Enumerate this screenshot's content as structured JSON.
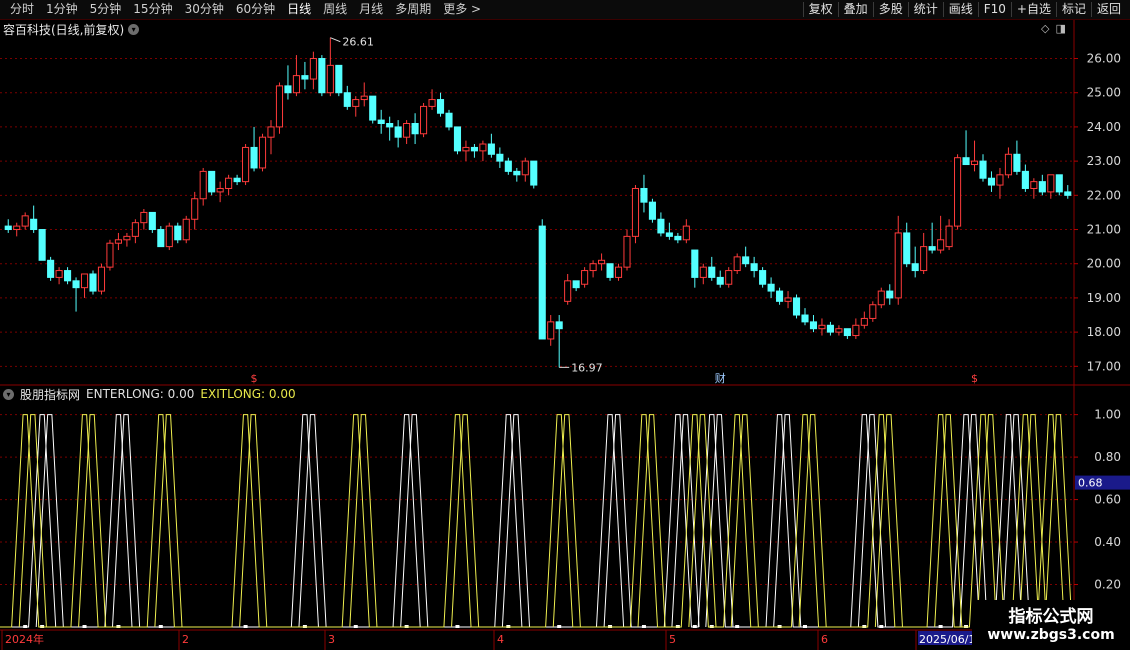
{
  "toolbar": {
    "periods": [
      "分时",
      "1分钟",
      "5分钟",
      "15分钟",
      "30分钟",
      "60分钟",
      "日线",
      "周线",
      "月线",
      "多周期",
      "更多 >"
    ],
    "active_period": "日线",
    "actions": [
      "复权",
      "叠加",
      "多股",
      "统计",
      "画线",
      "F10",
      "+自选",
      "标记",
      "返回"
    ]
  },
  "chart_title": "容百科技(日线,前复权)",
  "main_price_labels": {
    "high": "26.61",
    "low": "16.97"
  },
  "event_markers": [
    "$",
    "财",
    "$"
  ],
  "indicator": {
    "name": "股朋指标网",
    "enterlong": "ENTERLONG: 0.00",
    "exitlong": "EXITLONG: 0.00",
    "current_value": "0.68"
  },
  "date_axis": [
    "2024年",
    "2",
    "3",
    "4",
    "5",
    "6",
    "2025/06/1"
  ],
  "watermark": {
    "line1": "指标公式网",
    "line2": "www.zbgs3.com"
  },
  "colors": {
    "up": "#ff3b3b",
    "down": "#54ffff",
    "grid": "#7a0000",
    "enter": "#ffffff",
    "exit": "#f0f050"
  },
  "chart_data": [
    {
      "type": "candlestick",
      "title": "容百科技(日线,前复权)",
      "ylim": [
        16.6,
        26.6
      ],
      "yticks": [
        17.0,
        18.0,
        19.0,
        20.0,
        21.0,
        22.0,
        23.0,
        24.0,
        25.0,
        26.0
      ],
      "annotations": [
        {
          "label": "26.61",
          "value": 26.61
        },
        {
          "label": "16.97",
          "value": 16.97
        }
      ],
      "ohlc": [
        [
          21.1,
          21.3,
          20.9,
          21.0
        ],
        [
          21.0,
          21.2,
          20.8,
          21.1
        ],
        [
          21.1,
          21.5,
          21.0,
          21.4
        ],
        [
          21.3,
          21.7,
          20.9,
          21.0
        ],
        [
          21.0,
          21.0,
          20.1,
          20.1
        ],
        [
          20.1,
          20.2,
          19.5,
          19.6
        ],
        [
          19.6,
          19.9,
          19.4,
          19.8
        ],
        [
          19.8,
          19.9,
          19.4,
          19.5
        ],
        [
          19.5,
          19.6,
          18.6,
          19.3
        ],
        [
          19.3,
          19.7,
          19.0,
          19.7
        ],
        [
          19.7,
          19.8,
          19.1,
          19.2
        ],
        [
          19.2,
          20.0,
          19.1,
          19.9
        ],
        [
          19.9,
          20.7,
          19.8,
          20.6
        ],
        [
          20.6,
          20.9,
          20.4,
          20.7
        ],
        [
          20.7,
          20.9,
          20.5,
          20.8
        ],
        [
          20.8,
          21.3,
          20.6,
          21.2
        ],
        [
          21.2,
          21.6,
          21.0,
          21.5
        ],
        [
          21.5,
          21.5,
          20.9,
          21.0
        ],
        [
          21.0,
          21.1,
          20.5,
          20.5
        ],
        [
          20.5,
          21.2,
          20.4,
          21.1
        ],
        [
          21.1,
          21.2,
          20.6,
          20.7
        ],
        [
          20.7,
          21.4,
          20.6,
          21.3
        ],
        [
          21.3,
          22.1,
          21.0,
          21.9
        ],
        [
          21.9,
          22.8,
          21.7,
          22.7
        ],
        [
          22.7,
          22.7,
          22.0,
          22.1
        ],
        [
          22.1,
          22.4,
          21.8,
          22.2
        ],
        [
          22.2,
          22.6,
          22.0,
          22.5
        ],
        [
          22.5,
          22.6,
          22.3,
          22.4
        ],
        [
          22.4,
          23.5,
          22.3,
          23.4
        ],
        [
          23.4,
          24.0,
          22.7,
          22.8
        ],
        [
          22.8,
          23.8,
          22.7,
          23.7
        ],
        [
          23.7,
          24.2,
          23.2,
          24.0
        ],
        [
          24.0,
          25.3,
          23.8,
          25.2
        ],
        [
          25.2,
          25.8,
          24.8,
          25.0
        ],
        [
          25.0,
          26.1,
          24.9,
          25.5
        ],
        [
          25.5,
          25.9,
          25.1,
          25.4
        ],
        [
          25.4,
          26.2,
          25.1,
          26.0
        ],
        [
          26.0,
          26.1,
          24.9,
          25.0
        ],
        [
          25.0,
          26.61,
          24.9,
          25.8
        ],
        [
          25.8,
          25.8,
          24.9,
          25.0
        ],
        [
          25.0,
          25.2,
          24.5,
          24.6
        ],
        [
          24.6,
          24.9,
          24.3,
          24.8
        ],
        [
          24.8,
          25.3,
          24.6,
          24.9
        ],
        [
          24.9,
          24.9,
          24.1,
          24.2
        ],
        [
          24.2,
          24.5,
          23.8,
          24.1
        ],
        [
          24.1,
          24.3,
          23.6,
          24.0
        ],
        [
          24.0,
          24.2,
          23.4,
          23.7
        ],
        [
          23.7,
          24.2,
          23.5,
          24.1
        ],
        [
          24.1,
          24.4,
          23.5,
          23.8
        ],
        [
          23.8,
          24.7,
          23.7,
          24.6
        ],
        [
          24.6,
          25.1,
          24.5,
          24.8
        ],
        [
          24.8,
          25.0,
          24.3,
          24.4
        ],
        [
          24.4,
          24.5,
          23.9,
          24.0
        ],
        [
          24.0,
          24.0,
          23.2,
          23.3
        ],
        [
          23.3,
          23.6,
          23.0,
          23.4
        ],
        [
          23.4,
          23.5,
          23.1,
          23.3
        ],
        [
          23.3,
          23.6,
          23.0,
          23.5
        ],
        [
          23.5,
          23.8,
          23.1,
          23.2
        ],
        [
          23.2,
          23.4,
          22.8,
          23.0
        ],
        [
          23.0,
          23.1,
          22.6,
          22.7
        ],
        [
          22.7,
          22.8,
          22.4,
          22.6
        ],
        [
          22.6,
          23.1,
          22.4,
          23.0
        ],
        [
          23.0,
          23.0,
          22.2,
          22.3
        ],
        [
          21.1,
          21.3,
          17.8,
          17.8
        ],
        [
          17.8,
          18.5,
          17.6,
          18.3
        ],
        [
          18.3,
          18.5,
          16.97,
          18.1
        ],
        [
          18.9,
          19.7,
          18.8,
          19.5
        ],
        [
          19.5,
          19.5,
          19.2,
          19.3
        ],
        [
          19.4,
          19.9,
          19.3,
          19.8
        ],
        [
          19.8,
          20.1,
          19.6,
          20.0
        ],
        [
          20.0,
          20.3,
          19.8,
          20.1
        ],
        [
          20.0,
          20.0,
          19.5,
          19.6
        ],
        [
          19.6,
          20.0,
          19.5,
          19.9
        ],
        [
          19.9,
          21.0,
          19.8,
          20.8
        ],
        [
          20.8,
          22.3,
          20.6,
          22.2
        ],
        [
          22.2,
          22.6,
          21.5,
          21.8
        ],
        [
          21.8,
          21.9,
          21.2,
          21.3
        ],
        [
          21.3,
          21.5,
          20.8,
          20.9
        ],
        [
          20.9,
          21.2,
          20.7,
          20.8
        ],
        [
          20.8,
          20.9,
          20.6,
          20.7
        ],
        [
          20.7,
          21.3,
          20.6,
          21.1
        ],
        [
          20.4,
          20.4,
          19.3,
          19.6
        ],
        [
          19.6,
          20.0,
          19.4,
          19.9
        ],
        [
          19.9,
          20.2,
          19.5,
          19.6
        ],
        [
          19.6,
          19.8,
          19.3,
          19.4
        ],
        [
          19.4,
          19.9,
          19.3,
          19.8
        ],
        [
          19.8,
          20.3,
          19.7,
          20.2
        ],
        [
          20.2,
          20.5,
          19.9,
          20.0
        ],
        [
          20.0,
          20.2,
          19.6,
          19.8
        ],
        [
          19.8,
          19.9,
          19.3,
          19.4
        ],
        [
          19.4,
          19.6,
          19.0,
          19.2
        ],
        [
          19.2,
          19.3,
          18.8,
          18.9
        ],
        [
          18.9,
          19.2,
          18.7,
          19.0
        ],
        [
          19.0,
          19.1,
          18.4,
          18.5
        ],
        [
          18.5,
          18.7,
          18.2,
          18.3
        ],
        [
          18.3,
          18.5,
          18.0,
          18.1
        ],
        [
          18.1,
          18.4,
          17.9,
          18.2
        ],
        [
          18.2,
          18.3,
          17.9,
          18.0
        ],
        [
          18.0,
          18.2,
          17.9,
          18.1
        ],
        [
          18.1,
          18.1,
          17.8,
          17.9
        ],
        [
          17.9,
          18.4,
          17.8,
          18.2
        ],
        [
          18.2,
          18.6,
          18.1,
          18.4
        ],
        [
          18.4,
          18.9,
          18.3,
          18.8
        ],
        [
          18.8,
          19.3,
          18.7,
          19.2
        ],
        [
          19.2,
          19.4,
          18.8,
          19.0
        ],
        [
          19.0,
          21.4,
          18.8,
          20.9
        ],
        [
          20.9,
          21.2,
          19.9,
          20.0
        ],
        [
          20.0,
          20.5,
          19.6,
          19.8
        ],
        [
          19.8,
          20.9,
          19.7,
          20.5
        ],
        [
          20.5,
          21.2,
          20.3,
          20.4
        ],
        [
          20.4,
          21.4,
          20.3,
          20.7
        ],
        [
          20.5,
          21.3,
          20.4,
          21.1
        ],
        [
          21.1,
          23.2,
          21.0,
          23.1
        ],
        [
          23.1,
          23.9,
          22.9,
          22.9
        ],
        [
          22.9,
          23.6,
          22.7,
          23.0
        ],
        [
          23.0,
          23.2,
          22.4,
          22.5
        ],
        [
          22.5,
          22.7,
          22.1,
          22.3
        ],
        [
          22.3,
          22.8,
          21.9,
          22.6
        ],
        [
          22.6,
          23.4,
          22.5,
          23.2
        ],
        [
          23.2,
          23.6,
          22.6,
          22.7
        ],
        [
          22.7,
          22.9,
          22.1,
          22.2
        ],
        [
          22.2,
          22.5,
          21.9,
          22.4
        ],
        [
          22.4,
          22.6,
          22.0,
          22.1
        ],
        [
          22.1,
          22.6,
          21.9,
          22.6
        ],
        [
          22.6,
          22.6,
          22.0,
          22.1
        ],
        [
          22.1,
          22.3,
          21.9,
          22.0
        ]
      ]
    },
    {
      "type": "line",
      "title": "股朋指标网",
      "ylim": [
        0,
        1.05
      ],
      "yticks": [
        0.2,
        0.4,
        0.6,
        0.8,
        1.0
      ],
      "series": [
        {
          "name": "ENTERLONG",
          "peaks": [
            4,
            13,
            35,
            47,
            59,
            71,
            79,
            83,
            91,
            101,
            113,
            118
          ]
        },
        {
          "name": "EXITLONG",
          "peaks": [
            2,
            9,
            18,
            28,
            41,
            53,
            65,
            75,
            81,
            86,
            94,
            103,
            110,
            115,
            120,
            123
          ]
        }
      ]
    }
  ]
}
